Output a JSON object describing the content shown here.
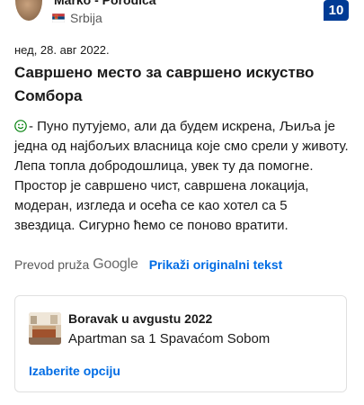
{
  "reviewer": {
    "name": "Marko - Porodica",
    "country": "Srbija",
    "score": "10"
  },
  "review": {
    "date": "нед, 28. авг 2022.",
    "title": "Савршено место за савршено искуство Сомбора",
    "body": "- Пуно путујемо, али да будем искрена, Љиља је једна од најбољих власница које смо срели у животу. Лепа топла добродошлица, увек ту да помогне. Простор је савршено чист, савршена локација, модеран, изгледа и осећа се као хотел са 5 звездица. Сигурно ћемо се поново вратити."
  },
  "translation": {
    "prefix": "Prevod pruža",
    "provider": "Google",
    "show_original": "Prikaži originalni tekst"
  },
  "stay": {
    "title": "Boravak u avgustu 2022",
    "room": "Apartman sa 1 Spavaćom Sobom",
    "choose": "Izaberite opciju"
  },
  "colors": {
    "brand_blue": "#003b95",
    "link_blue": "#006ce4",
    "smile_green": "#008009"
  }
}
